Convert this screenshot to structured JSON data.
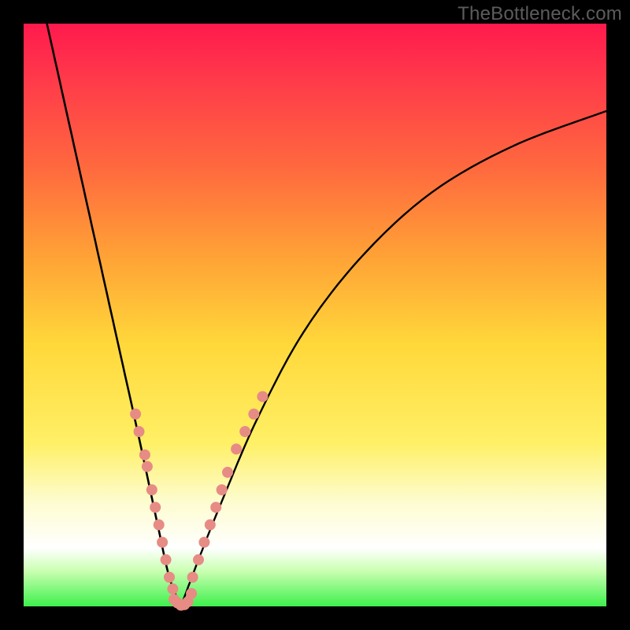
{
  "watermark": "TheBottleneck.com",
  "colors": {
    "background": "#000000",
    "gradient_top": "#ff1a4d",
    "gradient_mid1": "#ff6a3e",
    "gradient_mid2": "#ffd83a",
    "gradient_bottom_white": "#ffffff",
    "gradient_bottom_green": "#3ef04c",
    "curve": "#000000",
    "marker": "#e78b85"
  },
  "chart_data": {
    "type": "line",
    "title": "",
    "xlabel": "",
    "ylabel": "",
    "xlim": [
      0,
      100
    ],
    "ylim": [
      0,
      100
    ],
    "grid": false,
    "legend": false,
    "description": "V-shaped bottleneck curve with minimum near x≈27 (y≈0). Left branch is steep and nearly linear from top-left; right branch rises with decreasing slope toward the top-right corner.",
    "series": [
      {
        "name": "left_branch",
        "x": [
          4,
          8,
          12,
          16,
          20,
          23,
          25,
          27
        ],
        "y": [
          100,
          82,
          64,
          46,
          28,
          14,
          5,
          0
        ]
      },
      {
        "name": "right_branch",
        "x": [
          27,
          30,
          34,
          40,
          48,
          58,
          70,
          84,
          100
        ],
        "y": [
          0,
          8,
          18,
          32,
          47,
          60,
          71,
          79,
          85
        ]
      }
    ],
    "marker_points_left": {
      "name": "markers_left_branch",
      "comment": "salmon dotted segment on lower-left part of V",
      "x": [
        19.2,
        19.8,
        20.8,
        21.2,
        22.0,
        22.6,
        23.2,
        23.8,
        24.4,
        25.0,
        25.6
      ],
      "y": [
        33,
        30,
        26,
        24,
        20,
        17,
        14,
        11,
        8,
        5,
        3
      ]
    },
    "marker_points_right": {
      "name": "markers_right_branch",
      "comment": "salmon dotted segment on lower-right part of V",
      "x": [
        29.0,
        30.0,
        31.0,
        32.0,
        33.0,
        34.0,
        35.0,
        36.5,
        38.0,
        39.5,
        41.0
      ],
      "y": [
        5,
        8,
        11,
        14,
        17,
        20,
        23,
        27,
        30,
        33,
        36
      ]
    },
    "marker_points_trough": {
      "name": "markers_trough",
      "comment": "salmon dots across the flat trough of the V",
      "x": [
        25.8,
        26.4,
        27.0,
        27.6,
        28.2,
        28.8
      ],
      "y": [
        1.2,
        0.6,
        0.2,
        0.3,
        0.8,
        2.2
      ]
    }
  }
}
